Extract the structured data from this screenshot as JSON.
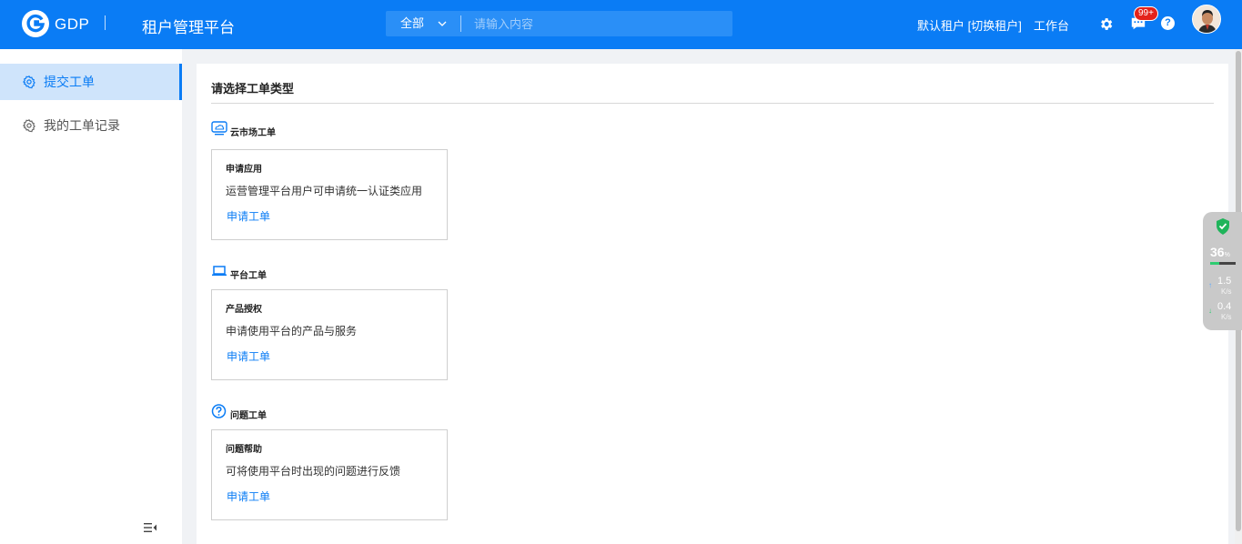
{
  "header": {
    "logo_text": "GDP",
    "app_title": "租户管理平台",
    "search": {
      "scope_selected": "全部",
      "placeholder": "请输入内容",
      "value": ""
    },
    "tenant_label": "默认租户 [切换租户]",
    "workbench_label": "工作台",
    "message_badge": "99+",
    "help_label": "?",
    "brand_color": "#0a7cf5"
  },
  "sidebar": {
    "items": [
      {
        "label": "提交工单",
        "active": true,
        "icon": "gear-icon"
      },
      {
        "label": "我的工单记录",
        "active": false,
        "icon": "gear-icon"
      }
    ],
    "collapse_icon": "menu-collapse-icon"
  },
  "main": {
    "title": "请选择工单类型",
    "sections": [
      {
        "heading": "云市场工单",
        "icon": "cloud-monitor-icon",
        "card": {
          "title": "申请应用",
          "description": "运营管理平台用户可申请统一认证类应用",
          "action": "申请工单"
        }
      },
      {
        "heading": "平台工单",
        "icon": "laptop-icon",
        "card": {
          "title": "产品授权",
          "description": "申请使用平台的产品与服务",
          "action": "申请工单"
        }
      },
      {
        "heading": "问题工单",
        "icon": "question-circle-icon",
        "card": {
          "title": "问题帮助",
          "description": "可将使用平台时出现的问题进行反馈",
          "action": "申请工单"
        }
      }
    ]
  },
  "net_widget": {
    "percent": "36",
    "percent_unit": "%",
    "percent_fill": 0.36,
    "upload": "1.5",
    "upload_unit": "K/s",
    "download": "0.4",
    "download_unit": "K/s",
    "up_arrow": "↑",
    "down_arrow": "↓"
  }
}
